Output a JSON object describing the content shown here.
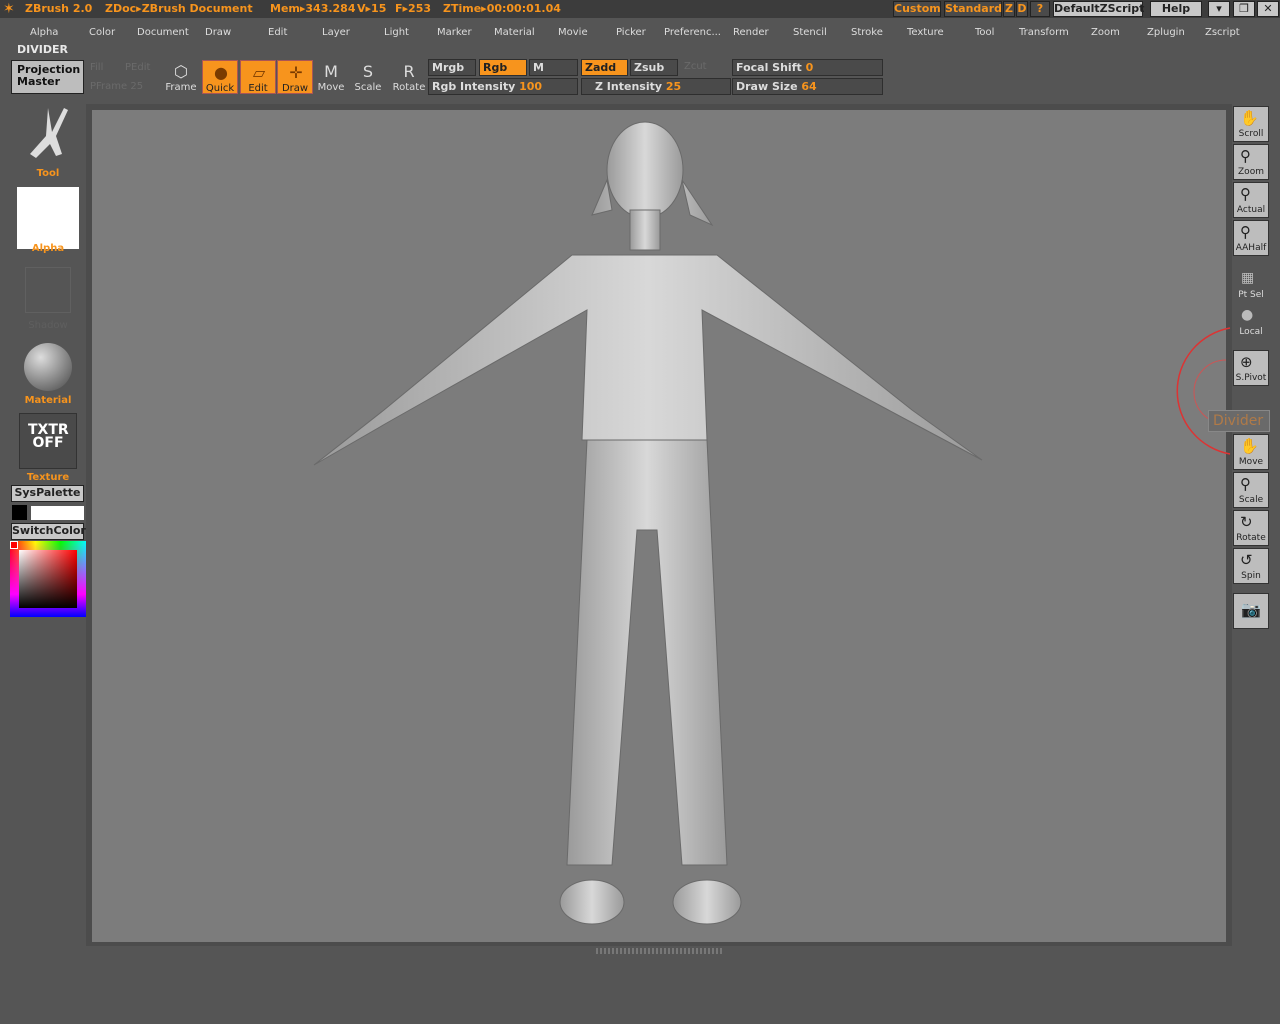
{
  "titlebar": {
    "app": "ZBrush 2.0",
    "doc": "ZDoc▸ZBrush Document",
    "mem": "Mem▸343.284",
    "v": "V▸15",
    "f": "F▸253",
    "ztime": "ZTime▸00:00:01.04",
    "buttons": [
      "Custom",
      "Standard",
      "Z",
      "D",
      "?",
      "DefaultZScript",
      "Help"
    ],
    "window_controls": [
      "minimize",
      "restore",
      "close"
    ]
  },
  "menu": [
    "Alpha",
    "Color",
    "Document",
    "Draw",
    "Edit",
    "Layer",
    "Light",
    "Marker",
    "Material",
    "Movie",
    "Picker",
    "Preferenc...",
    "Render",
    "Stencil",
    "Stroke",
    "Texture",
    "Tool",
    "Transform",
    "Zoom",
    "Zplugin",
    "Zscript"
  ],
  "divider_label": "DIVIDER",
  "toolbar": {
    "projection_master": "Projection Master",
    "disabled": [
      "Fill",
      "PEdit",
      "PFrame 25"
    ],
    "tools": [
      {
        "label": "Frame",
        "active": false
      },
      {
        "label": "Quick",
        "active": true
      },
      {
        "label": "Edit",
        "active": true
      },
      {
        "label": "Draw",
        "active": true
      },
      {
        "label": "Move",
        "active": false
      },
      {
        "label": "Scale",
        "active": false
      },
      {
        "label": "Rotate",
        "active": false
      }
    ],
    "mrgb": "Mrgb",
    "rgb": "Rgb",
    "m": "M",
    "zadd": "Zadd",
    "zsub": "Zsub",
    "zcut": "Zcut",
    "rgb_intensity_label": "Rgb Intensity",
    "rgb_intensity": "100",
    "z_intensity_label": "Z Intensity",
    "z_intensity": "25",
    "focal_shift_label": "Focal Shift",
    "focal_shift": "0",
    "draw_size_label": "Draw Size",
    "draw_size": "64"
  },
  "left": {
    "tool": "Tool",
    "alpha": "Alpha",
    "shadow": "Shadow",
    "material": "Material",
    "txtr": "TXTR OFF",
    "texture": "Texture",
    "syspalette": "SysPalette",
    "switchcolor": "SwitchColor",
    "main_color": "#000000",
    "secondary_color": "#ffffff"
  },
  "right": [
    "Scroll",
    "Zoom",
    "Actual",
    "AAHalf",
    "Pt Sel",
    "Local",
    "S.Pivot",
    "Move",
    "Scale",
    "Rotate",
    "Spin"
  ],
  "tooltip": "Divider",
  "colors": {
    "accent": "#f7941d",
    "canvas": "#7c7c7c"
  }
}
